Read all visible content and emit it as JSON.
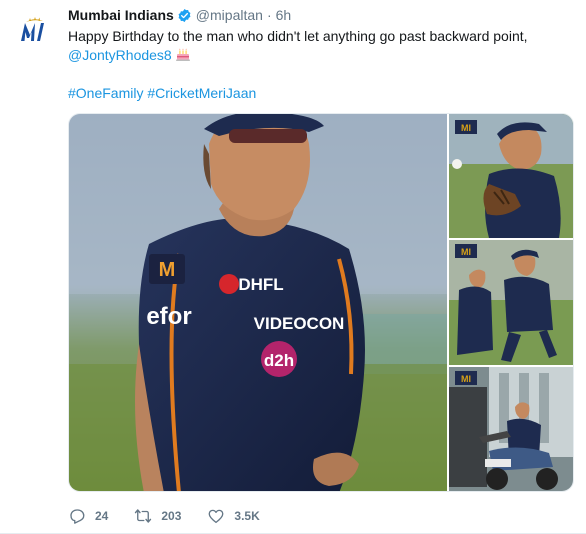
{
  "tweet": {
    "author": {
      "display_name": "Mumbai Indians",
      "handle": "@mipaltan",
      "verified": true,
      "avatar_icon": "mumbai-indians-logo",
      "avatar_text": "MI"
    },
    "separator": "·",
    "time": "6h",
    "text": {
      "line1": "Happy Birthday to the man who didn't let anything go past backward point,",
      "mention": "@JontyRhodes8",
      "emoji_icon": "birthday-cake-icon",
      "hashtags": [
        "#OneFamily",
        "#CricketMeriJaan"
      ]
    },
    "media": {
      "main_jersey_brands": [
        "DHFL",
        "VIDEOCON",
        "d2h",
        "efor",
        "M"
      ],
      "thumb_logo_text": "MI"
    },
    "actions": {
      "reply": {
        "icon": "reply-icon",
        "count": "24"
      },
      "retweet": {
        "icon": "retweet-icon",
        "count": "203"
      },
      "like": {
        "icon": "heart-icon",
        "count": "3.5K"
      }
    },
    "colors": {
      "link": "#1b95e0",
      "secondary": "#657786",
      "jersey_navy": "#1e2b4f",
      "jersey_orange": "#e07b1f"
    }
  }
}
